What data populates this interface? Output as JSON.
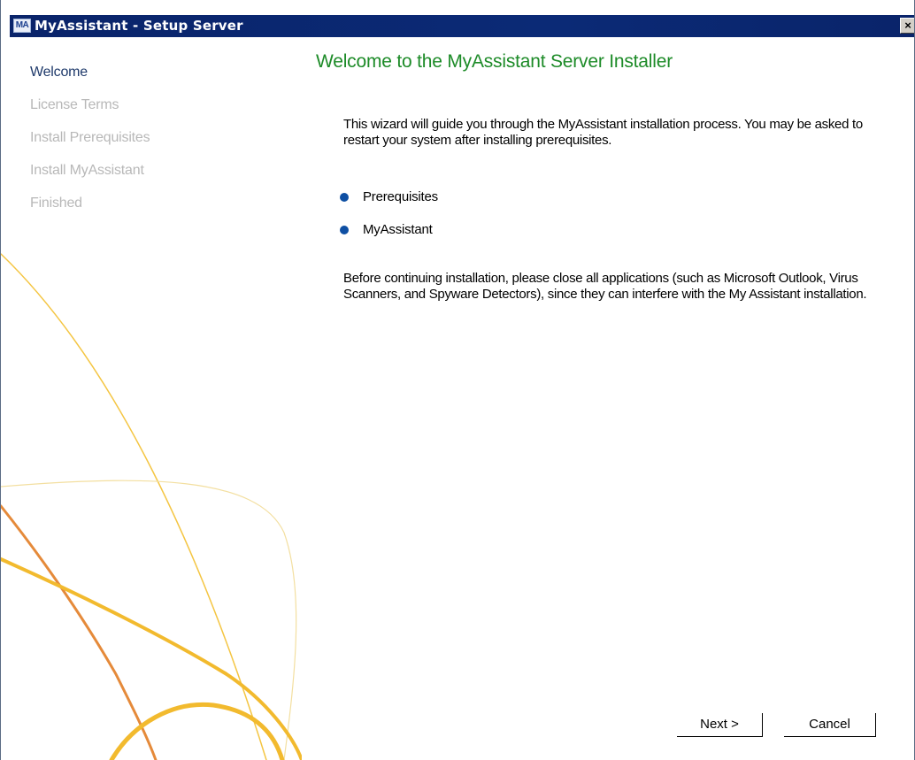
{
  "window": {
    "title": "MyAssistant - Setup Server",
    "icon_label": "MA",
    "icon": "app-icon",
    "close_label": "×",
    "close_icon": "close-icon"
  },
  "sidebar": {
    "steps": [
      {
        "label": "Welcome",
        "active": true
      },
      {
        "label": "License Terms",
        "active": false
      },
      {
        "label": "Install Prerequisites",
        "active": false
      },
      {
        "label": "Install MyAssistant",
        "active": false
      },
      {
        "label": "Finished",
        "active": false
      }
    ]
  },
  "main": {
    "heading": "Welcome to the MyAssistant Server Installer",
    "intro": "This wizard will guide you through the MyAssistant installation process. You may be asked to restart your system after installing prerequisites.",
    "items": [
      {
        "label": "Prerequisites"
      },
      {
        "label": "MyAssistant"
      }
    ],
    "notice": "Before continuing installation, please close all applications (such as Microsoft Outlook, Virus Scanners, and Spyware Detectors), since they can interfere with the My Assistant installation."
  },
  "buttons": {
    "next_label": "Next >",
    "cancel_label": "Cancel"
  },
  "colors": {
    "title_bar": "#0a246a",
    "heading": "#1d8b28",
    "active_step": "#1f3a6b",
    "inactive_step": "#b8b8b8",
    "bullet": "#0e4fa3",
    "decor_arc": "#f1b928",
    "decor_accent": "#e08a3a"
  }
}
